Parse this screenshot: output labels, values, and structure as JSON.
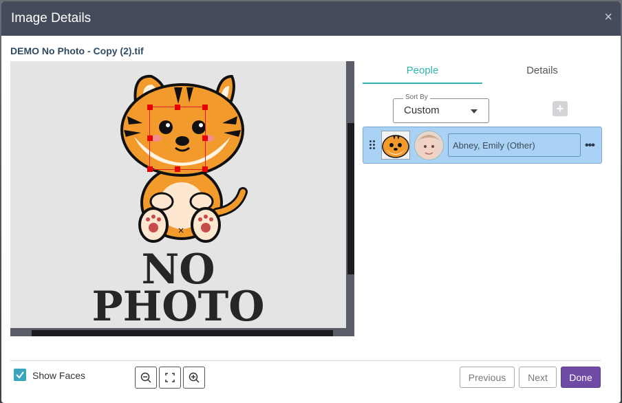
{
  "dialog": {
    "title": "Image Details",
    "close_glyph": "×",
    "filename": "DEMO No Photo - Copy (2).tif"
  },
  "image": {
    "text_line1": "NO",
    "text_line2": "PHOTO",
    "show_faces": true
  },
  "tabs": [
    {
      "label": "People",
      "active": true
    },
    {
      "label": "Details",
      "active": false
    }
  ],
  "sort": {
    "label": "Sort By",
    "value": "Custom"
  },
  "add_button": {
    "icon": "plus-icon",
    "glyph": "+"
  },
  "people": [
    {
      "name": "Abney, Emily (Other)",
      "more_glyph": "•••"
    }
  ],
  "footer": {
    "show_faces_label": "Show Faces",
    "tools": [
      "zoom-out-icon",
      "fit-screen-icon",
      "zoom-in-icon"
    ],
    "previous_label": "Previous",
    "next_label": "Next",
    "done_label": "Done"
  },
  "colors": {
    "header_bg": "#444b5a",
    "accent_teal": "#2eb5ad",
    "selected_row": "#a9d2f5",
    "done_button": "#6f4ba6",
    "face_box": "#e01818"
  }
}
